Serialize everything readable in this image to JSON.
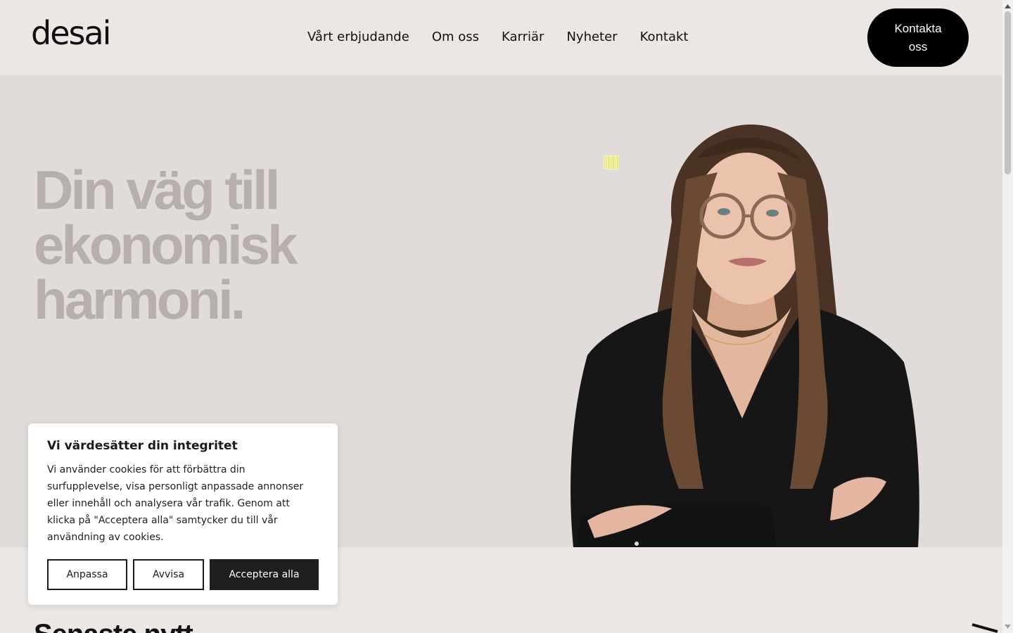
{
  "header": {
    "logo_text": "desai",
    "nav": [
      {
        "label": "Vårt erbjudande"
      },
      {
        "label": "Om oss"
      },
      {
        "label": "Karriär"
      },
      {
        "label": "Nyheter"
      },
      {
        "label": "Kontakt"
      }
    ],
    "cta_label": "Kontakta oss"
  },
  "hero": {
    "title": "Din väg till ekonomisk harmoni.",
    "image_alt": "Portrait of woman with glasses and long hair, arms crossed"
  },
  "next_section": {
    "heading": "Senaste nytt"
  },
  "cookie_banner": {
    "title": "Vi värdesätter din integritet",
    "body": "Vi använder cookies för att förbättra din surfupplevelse, visa personligt anpassade annonser eller innehåll och analysera vår trafik. Genom att klicka på \"Acceptera alla\" samtycker du till vår användning av cookies.",
    "customize_label": "Anpassa",
    "reject_label": "Avvisa",
    "accept_label": "Acceptera alla"
  },
  "colors": {
    "header_bg": "#ece7e5",
    "hero_bg": "#e1dcd9",
    "hero_title": "#b6afac",
    "cta_bg": "#000000",
    "accept_bg": "#1f1f1f",
    "barcode_accent": "#f1f08a"
  }
}
